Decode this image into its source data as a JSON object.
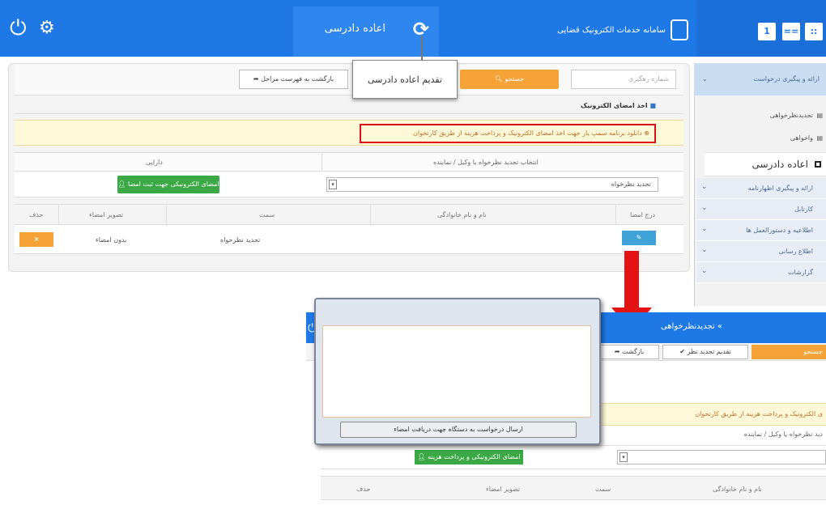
{
  "header": {
    "page_title": "اعاده دادرسی",
    "brand": "سامانه خدمات الکترونیک قضایی",
    "tooltip": "تقدیم اعاده دادرسی",
    "right_buttons": [
      "1",
      "==",
      "::"
    ],
    "colors": {
      "bar": "#1e78e6",
      "accent": "#f5a336",
      "green": "#3aa845",
      "red": "#e41313"
    }
  },
  "toolbar": {
    "search_placeholder": "شماره رهگیری",
    "search_label": "جستجو",
    "back_label": "بازگشت به فهرست مراحل"
  },
  "section": {
    "title": "اخذ امضای الکترونیک",
    "note": "دانلود برنامه سمپ یار جهت اخذ امضای الکترونیک و پرداخت هزینه از طریق کارتخوان"
  },
  "form": {
    "left_header": "دارایی",
    "right_header": "انتخاب تجدید نظرخواه یا وکیل / نماینده",
    "selected_value": "تجدید نظرخواه",
    "sign_button": "امضای الکترونیکی جهت ثبت امضا"
  },
  "table": {
    "headers": [
      "درج امضا",
      "نام و نام خانوادگی",
      "سمت",
      "تصویر امضاء",
      "حذف"
    ],
    "row": {
      "role": "تجدید نظرخواه",
      "signature": "بدون امضاء",
      "delete": "×",
      "edit": "✎"
    }
  },
  "sidebar": {
    "head": "ارائه و پیگیری درخواست",
    "items": [
      {
        "label": "تجدیدنظرخواهی",
        "icon": "▤"
      },
      {
        "label": "واخواهی",
        "icon": "▤"
      }
    ],
    "active": "اعاده دادرسی",
    "groups": [
      {
        "label": "ارائه و پیگیری اظهارنامه"
      },
      {
        "label": "کارتابل"
      },
      {
        "label": "اطلاعیه و دستورالعمل ها"
      },
      {
        "label": "اطلاع رسانی"
      },
      {
        "label": "گزارشات"
      }
    ]
  },
  "second": {
    "title": "تجدیدنظرخواهی",
    "search": "جستجو",
    "renew": "تقدیم تجدید نظر",
    "back": "بازگشت",
    "note": "ی الکترونیک و پرداخت هزینه از طریق کارتخوان",
    "subhdr": "دید نظرخواه یا وکیل / نماینده",
    "sign": "امضای الکترونیکی و پرداخت هزینه",
    "headers": [
      "نام و نام خانوادگی",
      "سمت",
      "تصویر امضاء",
      "حذف"
    ]
  },
  "dialog": {
    "button": "ارسال درخواست به دستگاه جهت دریافت امضاء"
  }
}
